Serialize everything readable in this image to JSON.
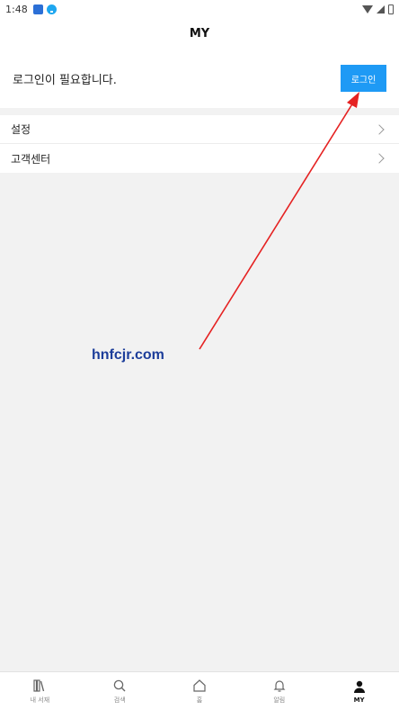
{
  "status_bar": {
    "time": "1:48"
  },
  "header": {
    "title": "MY"
  },
  "login": {
    "message": "로그인이 필요합니다.",
    "button_label": "로그인"
  },
  "menu": {
    "items": [
      {
        "label": "설정"
      },
      {
        "label": "고객센터"
      }
    ]
  },
  "watermark": {
    "text": "hnfcjr.com"
  },
  "bottom_nav": {
    "items": [
      {
        "label": "내 서재",
        "icon": "bookshelf-icon"
      },
      {
        "label": "검색",
        "icon": "search-icon"
      },
      {
        "label": "홈",
        "icon": "home-icon"
      },
      {
        "label": "알림",
        "icon": "bell-icon"
      },
      {
        "label": "MY",
        "icon": "person-icon",
        "active": true
      }
    ]
  },
  "colors": {
    "accent": "#1e9af5",
    "annotation": "#e52222"
  }
}
